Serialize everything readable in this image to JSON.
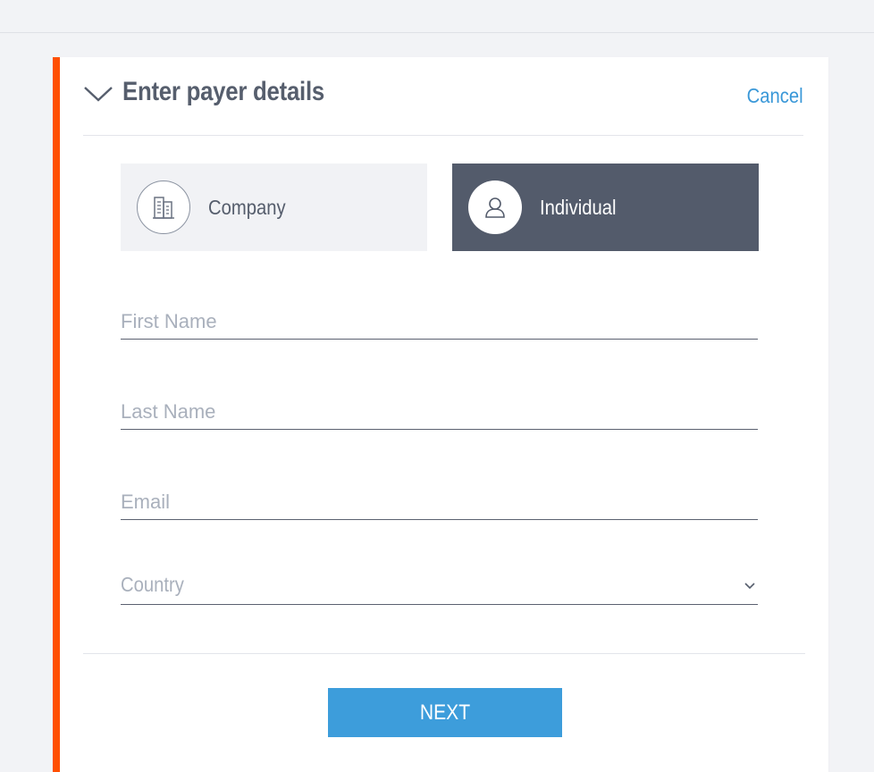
{
  "header": {
    "title": "Enter payer details",
    "cancel_label": "Cancel"
  },
  "payer_type": {
    "options": [
      {
        "label": "Company",
        "icon": "building-icon",
        "selected": false
      },
      {
        "label": "Individual",
        "icon": "user-icon",
        "selected": true
      }
    ]
  },
  "form": {
    "first_name": {
      "placeholder": "First Name",
      "value": ""
    },
    "last_name": {
      "placeholder": "Last Name",
      "value": ""
    },
    "email": {
      "placeholder": "Email",
      "value": ""
    },
    "country": {
      "placeholder": "Country",
      "value": ""
    }
  },
  "footer": {
    "next_label": "NEXT"
  },
  "colors": {
    "accent_bar": "#ff4f00",
    "link": "#3a98d8",
    "button": "#3d9ddb",
    "selected_segment": "#535b6b"
  }
}
